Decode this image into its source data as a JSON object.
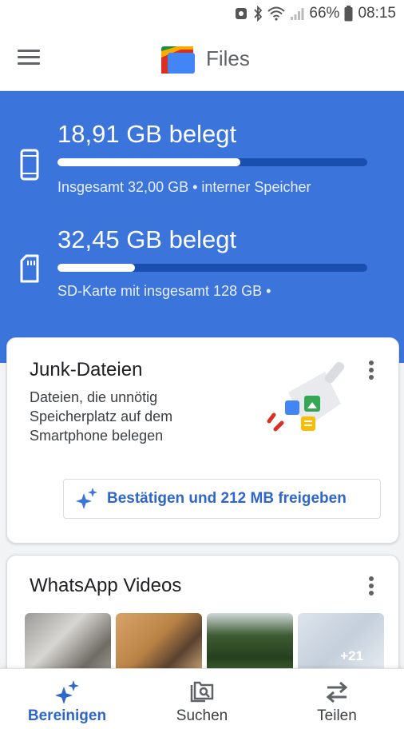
{
  "status_bar": {
    "battery_percent": "66%",
    "time": "08:15",
    "icons": [
      "data-saver-icon",
      "bluetooth-icon",
      "wifi-icon",
      "cell-signal-icon",
      "battery-icon"
    ]
  },
  "app_bar": {
    "menu_icon": "menu-icon",
    "logo_icon": "files-logo-icon",
    "title": "Files"
  },
  "storage": {
    "internal": {
      "icon": "phone-icon",
      "used": "18,91 GB belegt",
      "usage_fraction": 0.59,
      "detail": "Insgesamt 32,00 GB • interner Speicher"
    },
    "sd_card": {
      "icon": "sd-card-icon",
      "used": "32,45 GB belegt",
      "usage_fraction": 0.25,
      "detail": "SD-Karte mit insgesamt 128 GB •"
    },
    "colors": {
      "background": "#3b74db",
      "track": "#1a4fb0",
      "fill": "#ffffff"
    }
  },
  "junk_card": {
    "title": "Junk-Dateien",
    "description": "Dateien, die unnötig Speicherplatz auf dem Smartphone belegen",
    "action_label": "Bestätigen und 212 MB freigeben",
    "action_icon": "sparkle-icon",
    "illustration": "junk-files-illustration"
  },
  "whatsapp_card": {
    "title": "WhatsApp Videos",
    "more_count": "+21"
  },
  "bottom_nav": {
    "items": [
      {
        "label": "Bereinigen",
        "icon": "sparkle-icon",
        "active": true
      },
      {
        "label": "Suchen",
        "icon": "search-files-icon",
        "active": false
      },
      {
        "label": "Teilen",
        "icon": "swap-arrows-icon",
        "active": false
      }
    ],
    "accent_color": "#2f66cb"
  }
}
